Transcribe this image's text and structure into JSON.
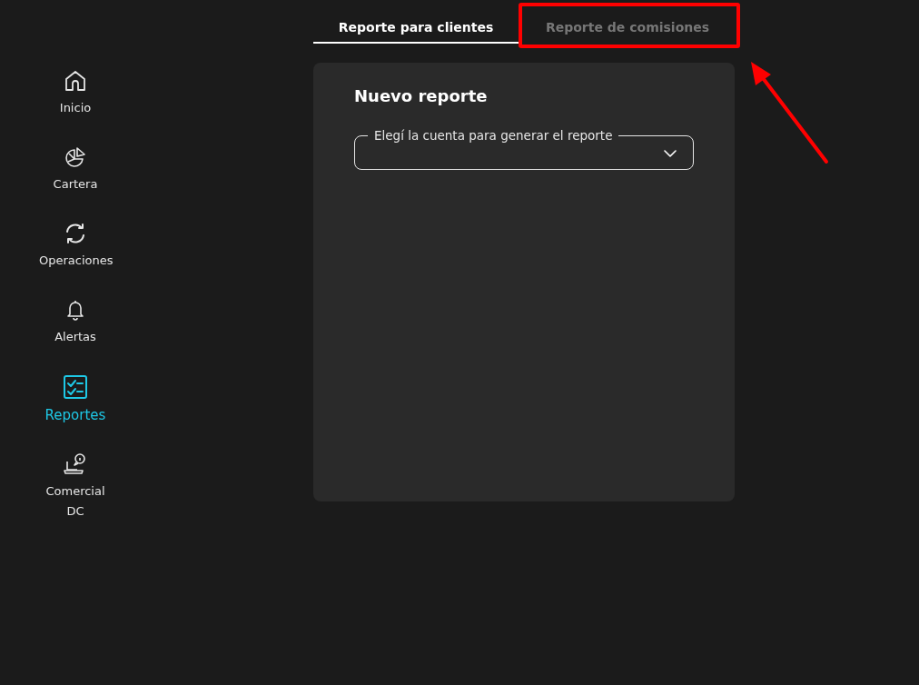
{
  "sidebar": {
    "items": [
      {
        "label": "Inicio",
        "selected": false
      },
      {
        "label": "Cartera",
        "selected": false
      },
      {
        "label": "Operaciones",
        "selected": false
      },
      {
        "label": "Alertas",
        "selected": false
      },
      {
        "label": "Reportes",
        "selected": true
      },
      {
        "label": "Comercial DC",
        "selected": false
      }
    ]
  },
  "tabs": [
    {
      "label": "Reporte para clientes",
      "selected": true
    },
    {
      "label": "Reporte de comisiones",
      "selected": false
    }
  ],
  "card": {
    "title": "Nuevo reporte",
    "select": {
      "label": "Elegí la cuenta para generar el reporte"
    }
  }
}
